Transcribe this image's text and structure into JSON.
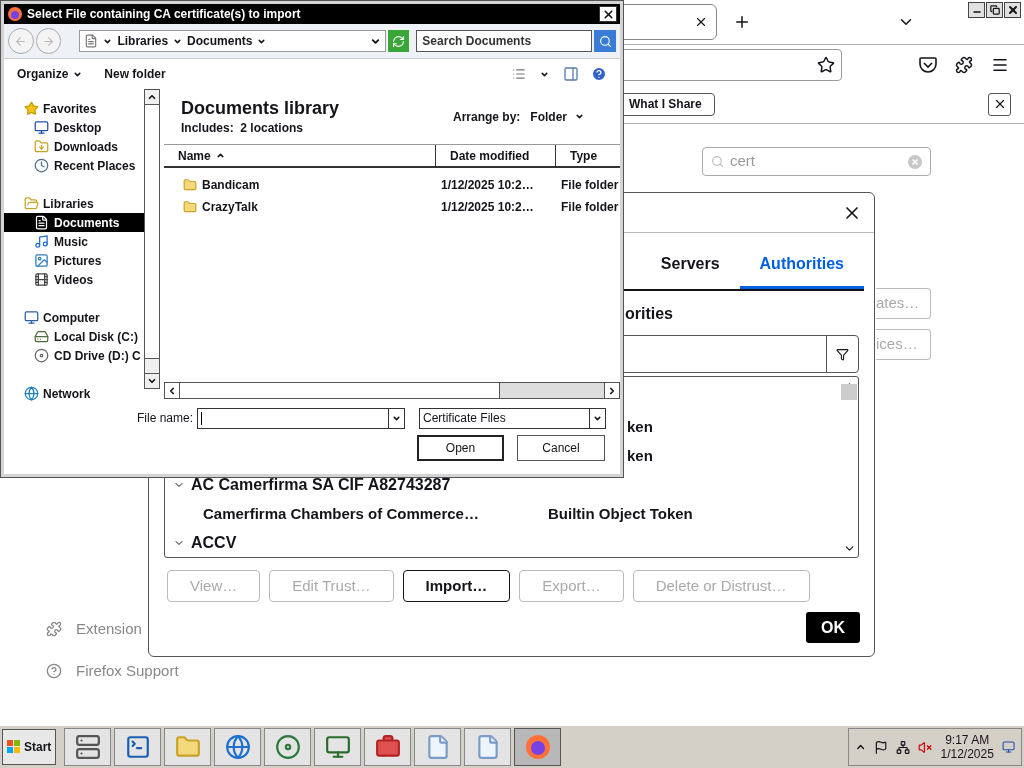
{
  "browser": {
    "privacy_button": "What I Share",
    "search": {
      "value": "cert"
    },
    "side_buttons": [
      "ates…",
      "ices…"
    ],
    "sidebar_links": [
      {
        "kind": "extension",
        "label": "Extension"
      },
      {
        "kind": "help",
        "label": "Firefox Support"
      }
    ]
  },
  "cert_manager": {
    "tabs": [
      {
        "label": "Servers",
        "selected": false
      },
      {
        "label": "Authorities",
        "selected": true
      }
    ],
    "heading": "orities",
    "rows": [
      {
        "kind": "partial",
        "text": "ken"
      },
      {
        "kind": "partial",
        "text": "ken"
      },
      {
        "kind": "group",
        "label": "AC Camerfirma SA CIF A82743287",
        "expanded": true
      },
      {
        "kind": "cert",
        "name": "Camerfirma Chambers of Commerce…",
        "token": "Builtin Object Token"
      },
      {
        "kind": "group",
        "label": "ACCV",
        "expanded": true
      }
    ],
    "buttons": [
      {
        "label": "View…",
        "disabled": true
      },
      {
        "label": "Edit Trust…",
        "disabled": true
      },
      {
        "label": "Import…",
        "disabled": false
      },
      {
        "label": "Export…",
        "disabled": true
      },
      {
        "label": "Delete or Distrust…",
        "disabled": true
      }
    ],
    "ok": "OK"
  },
  "file_dialog": {
    "title": "Select File containing CA certificate(s) to import",
    "breadcrumb": [
      "Libraries",
      "Documents"
    ],
    "search": {
      "placeholder": "Search Documents"
    },
    "toolbar": {
      "organize": "Organize",
      "new_folder": "New folder"
    },
    "nav": [
      {
        "kind": "star",
        "label": "Favorites",
        "selected": false,
        "children": [
          {
            "kind": "desktop",
            "label": "Desktop",
            "selected": false
          },
          {
            "kind": "downloads",
            "label": "Downloads",
            "selected": false
          },
          {
            "kind": "recent",
            "label": "Recent Places",
            "selected": false
          }
        ]
      },
      {
        "kind": "library",
        "label": "Libraries",
        "selected": false,
        "children": [
          {
            "kind": "documents",
            "label": "Documents",
            "selected": true
          },
          {
            "kind": "music",
            "label": "Music",
            "selected": false
          },
          {
            "kind": "pictures",
            "label": "Pictures",
            "selected": false
          },
          {
            "kind": "videos",
            "label": "Videos",
            "selected": false
          }
        ]
      },
      {
        "kind": "computer",
        "label": "Computer",
        "selected": false,
        "children": [
          {
            "kind": "disk",
            "label": "Local Disk (C:)",
            "selected": false
          },
          {
            "kind": "cd",
            "label": "CD Drive (D:) C",
            "selected": false
          }
        ]
      },
      {
        "kind": "network",
        "label": "Network",
        "selected": false
      }
    ],
    "library_title": "Documents library",
    "includes": "Includes:  2 locations",
    "arrange_label": "Arrange by:",
    "arrange_value": "Folder",
    "columns": [
      {
        "label": "Name",
        "sorted": true
      },
      {
        "label": "Date modified",
        "sorted": false
      },
      {
        "label": "Type",
        "sorted": false
      }
    ],
    "rows": [
      {
        "name": "Bandicam",
        "date": "1/12/2025 10:2…",
        "type": "File folder"
      },
      {
        "name": "CrazyTalk",
        "date": "1/12/2025 10:2…",
        "type": "File folder"
      }
    ],
    "file_name_label": "File name:",
    "filter": "Certificate Files",
    "open": "Open",
    "cancel": "Cancel"
  },
  "taskbar": {
    "start": "Start",
    "apps": [
      {
        "kind": "server",
        "selected": false
      },
      {
        "kind": "terminal",
        "selected": false
      },
      {
        "kind": "folder",
        "selected": false
      },
      {
        "kind": "browser",
        "selected": false
      },
      {
        "kind": "globe",
        "selected": false
      },
      {
        "kind": "monitor",
        "selected": false
      },
      {
        "kind": "toolbox",
        "selected": false
      },
      {
        "kind": "document",
        "selected": false
      },
      {
        "kind": "document",
        "selected": false
      },
      {
        "kind": "firefox",
        "selected": true
      }
    ],
    "time": "9:17 AM",
    "date": "1/12/2025"
  }
}
